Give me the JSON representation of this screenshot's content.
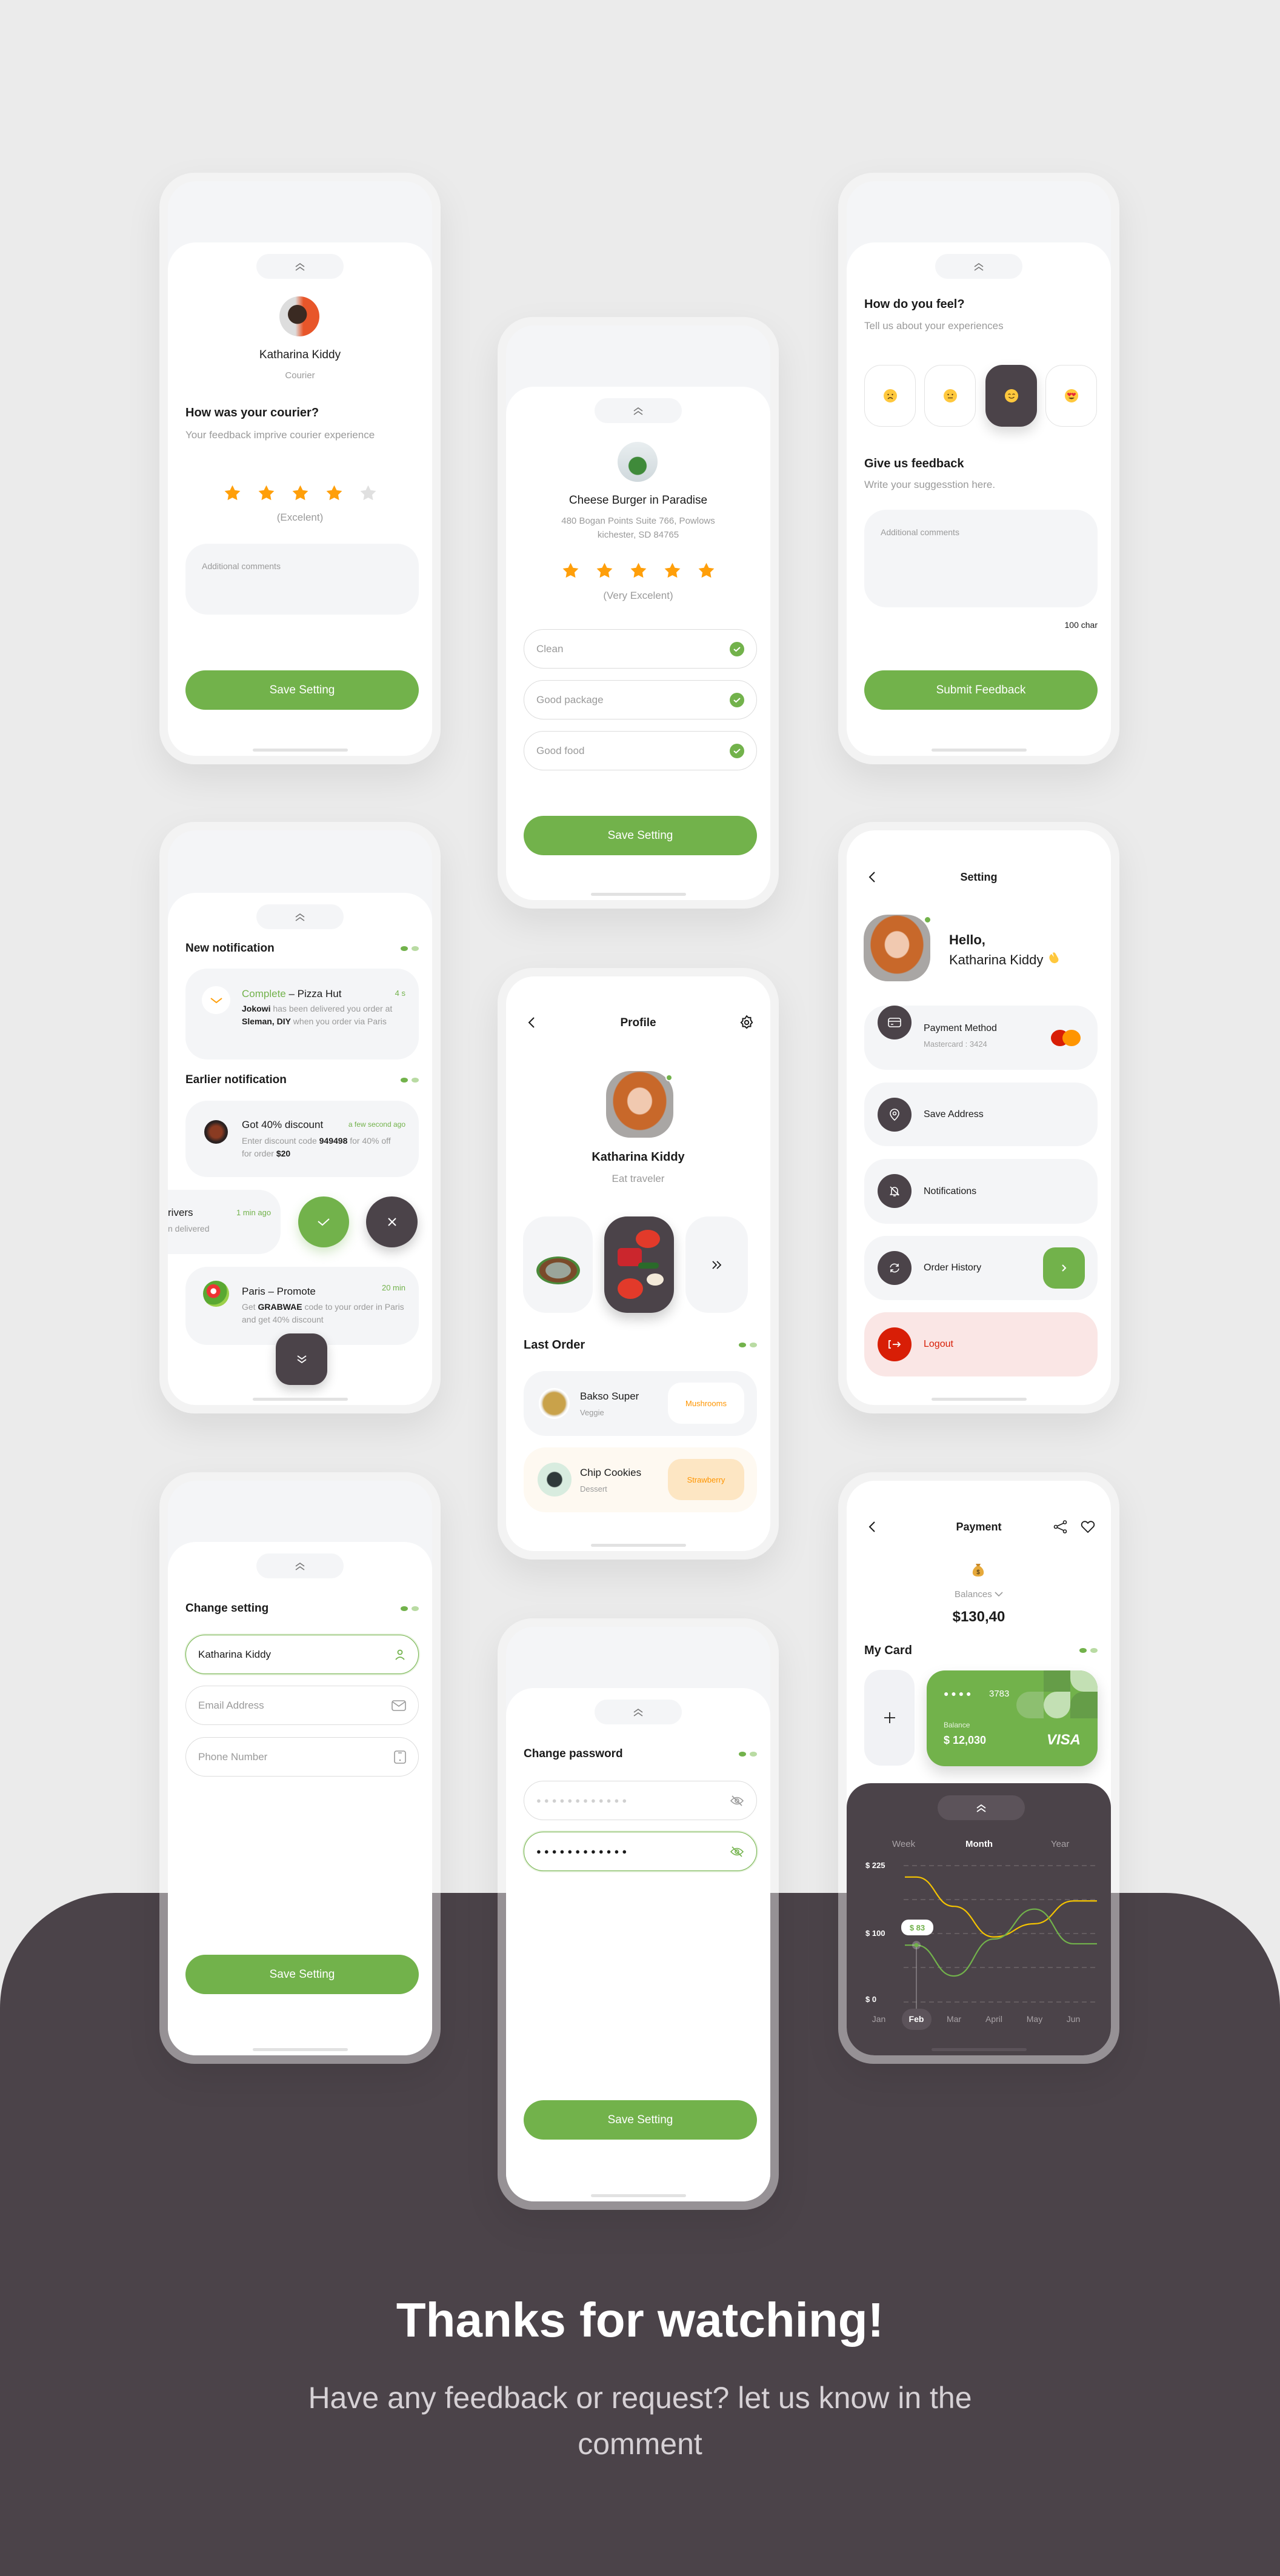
{
  "colors": {
    "accent": "#72b24b",
    "accent_light": "#b9dba3",
    "dark": "#4b4349",
    "star": "#ff9f0a",
    "star_empty": "#e0e0e0",
    "logout": "#d81e06",
    "orange": "#ff9500",
    "chart_line_1": "#f5c400",
    "chart_line_2": "#72b24b"
  },
  "courier_rating": {
    "name": "Katharina Kiddy",
    "role": "Courier",
    "question": "How was your courier?",
    "subtitle": "Your feedback imprive courier experience",
    "rating": 4,
    "max_rating": 5,
    "rating_label": "(Excelent)",
    "comment_placeholder": "Additional comments",
    "button": "Save Setting"
  },
  "restaurant_rating": {
    "name": "Cheese Burger in Paradise",
    "address_line1": "480 Bogan Points Suite 766, Powlows",
    "address_line2": "kichester, SD 84765",
    "rating": 5,
    "max_rating": 5,
    "rating_label": "(Very Excelent)",
    "tags": [
      {
        "label": "Clean",
        "checked": true
      },
      {
        "label": "Good package",
        "checked": true
      },
      {
        "label": "Good food",
        "checked": true
      }
    ],
    "button": "Save Setting"
  },
  "feeling": {
    "question": "How do you feel?",
    "subtitle": "Tell us about your experiences",
    "moods": [
      {
        "icon": "sad-face-icon",
        "selected": false
      },
      {
        "icon": "neutral-face-icon",
        "selected": false
      },
      {
        "icon": "smiling-face-icon",
        "selected": true
      },
      {
        "icon": "heart-eyes-face-icon",
        "selected": false
      }
    ],
    "feedback_title": "Give us feedback",
    "feedback_subtitle": "Write your suggesstion here.",
    "comment_placeholder": "Additional comments",
    "char_limit": "100 char",
    "button": "Submit Feedback"
  },
  "notifications": {
    "new_title": "New notification",
    "new_item": {
      "status": "Complete",
      "title": " – Pizza Hut",
      "time": "4 s",
      "body": [
        {
          "text": "Jokowi",
          "bold": true
        },
        {
          "text": " has been delivered you order at ",
          "bold": false
        },
        {
          "text": "Sleman, DIY",
          "bold": true
        },
        {
          "text": " when you order via Paris",
          "bold": false
        }
      ]
    },
    "earlier_title": "Earlier notification",
    "earlier_items": [
      {
        "title": "Got 40% discount",
        "time": "a few second ago",
        "body": [
          {
            "text": "Enter discount code ",
            "bold": false
          },
          {
            "text": "949498",
            "bold": true
          },
          {
            "text": " for 40% off for order ",
            "bold": false
          },
          {
            "text": "$20",
            "bold": true
          }
        ]
      },
      {
        "title": "rivers",
        "time": "1 min ago",
        "body_visible": "n delivered"
      },
      {
        "title": "Paris – Promote",
        "time": "20 min",
        "body": [
          {
            "text": "Get ",
            "bold": false
          },
          {
            "text": "GRABWAE",
            "bold": true
          },
          {
            "text": " code to your order in Paris and get 40% discount",
            "bold": false
          }
        ]
      }
    ]
  },
  "profile": {
    "title": "Profile",
    "name": "Katharina Kiddy",
    "bio": "Eat traveler",
    "last_order_title": "Last Order",
    "orders": [
      {
        "name": "Bakso Super",
        "category": "Veggie",
        "tag": "Mushrooms"
      },
      {
        "name": "Chip Cookies",
        "category": "Dessert",
        "tag": "Strawberry"
      }
    ]
  },
  "settings": {
    "title": "Setting",
    "greeting": "Hello,",
    "name": "Katharina Kiddy",
    "items": [
      {
        "label": "Payment Method",
        "sub": "Mastercard : 3424",
        "icon": "credit-card-icon"
      },
      {
        "label": "Save Address",
        "icon": "location-pin-icon"
      },
      {
        "label": "Notifications",
        "icon": "bell-off-icon"
      },
      {
        "label": "Order History",
        "icon": "refresh-icon"
      },
      {
        "label": "Logout",
        "icon": "logout-icon"
      }
    ]
  },
  "change_setting": {
    "title": "Change setting",
    "name_value": "Katharina Kiddy",
    "email_placeholder": "Email Address",
    "phone_placeholder": "Phone Number",
    "button": "Save Setting"
  },
  "change_password": {
    "title": "Change password",
    "password_mask": "●●●●●●●●●●●●",
    "confirm_mask": "●●●●●●●●●●●●",
    "button": "Save Setting"
  },
  "payment": {
    "title": "Payment",
    "balance_label": "Balances",
    "balance": "$130,40",
    "my_card_title": "My Card",
    "card": {
      "number_mask": "● ● ● ●",
      "last4": "3783",
      "balance_label": "Balance",
      "balance": "$ 12,030",
      "brand": "VISA"
    },
    "tabs": [
      {
        "label": "Week",
        "active": false
      },
      {
        "label": "Month",
        "active": true
      },
      {
        "label": "Year",
        "active": false
      }
    ]
  },
  "chart_data": {
    "type": "line",
    "categories": [
      "Jan",
      "Feb",
      "Mar",
      "April",
      "May",
      "Jun"
    ],
    "selected_category": "Feb",
    "y_ticks": [
      "$ 225",
      "$ 100",
      "$ 0"
    ],
    "y_tick_values": [
      225,
      100,
      0
    ],
    "series": [
      {
        "color": "#f5c400",
        "values": [
          null,
          204,
          150,
          95,
          118,
          160
        ]
      },
      {
        "color": "#72b24b",
        "values": [
          null,
          83,
          38,
          92,
          145,
          85
        ]
      }
    ],
    "tooltip": "$ 83",
    "grid": true
  },
  "footer": {
    "title": "Thanks for watching!",
    "subtitle": "Have any feedback or request? let us know in the comment"
  }
}
